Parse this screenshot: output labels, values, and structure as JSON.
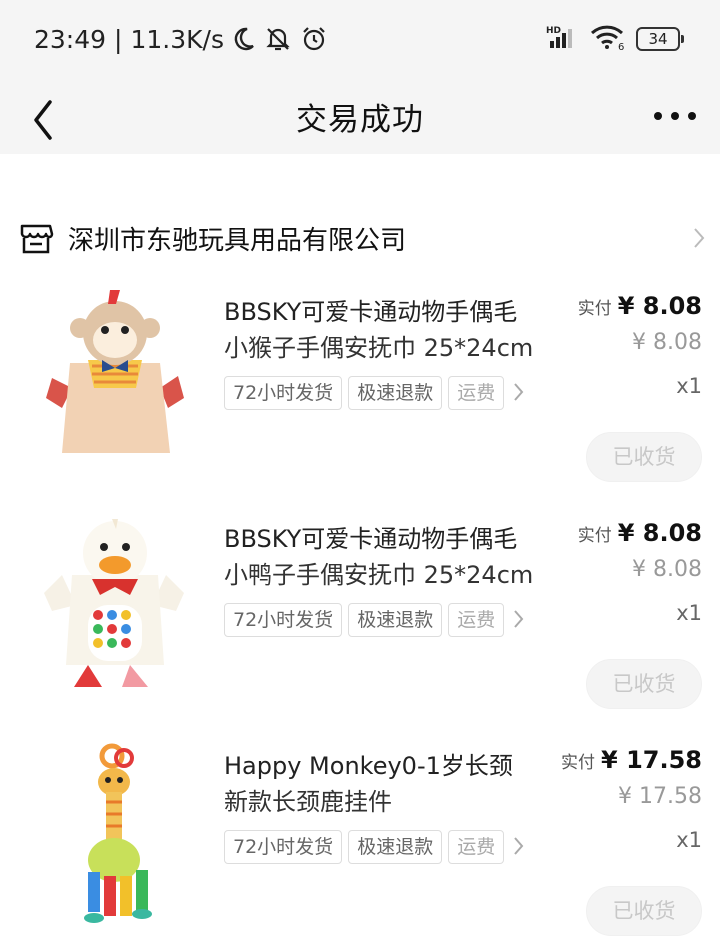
{
  "status": {
    "time": "23:49",
    "speed": "11.3K/s",
    "network": "HD",
    "wifi_badge": "6",
    "battery": "34"
  },
  "nav": {
    "title": "交易成功"
  },
  "shop": {
    "name": "深圳市东驰玩具用品有限公司"
  },
  "items": [
    {
      "title_line1": "BBSKY可爱卡通动物手偶毛",
      "title_line2": "小猴子手偶安抚巾 25*24cm",
      "tags": [
        "72小时发货",
        "极速退款",
        "运费"
      ],
      "price_label": "实付",
      "price": "¥ 8.08",
      "original_price": "¥ 8.08",
      "quantity": "x1",
      "action": "已收货"
    },
    {
      "title_line1": "BBSKY可爱卡通动物手偶毛",
      "title_line2": "小鸭子手偶安抚巾 25*24cm",
      "tags": [
        "72小时发货",
        "极速退款",
        "运费"
      ],
      "price_label": "实付",
      "price": "¥ 8.08",
      "original_price": "¥ 8.08",
      "quantity": "x1",
      "action": "已收货"
    },
    {
      "title_line1": "Happy Monkey0-1岁长颈",
      "title_line2": "新款长颈鹿挂件",
      "tags": [
        "72小时发货",
        "极速退款",
        "运费"
      ],
      "price_label": "实付",
      "price": "¥ 17.58",
      "original_price": "¥ 17.58",
      "quantity": "x1",
      "action": "已收货"
    }
  ]
}
